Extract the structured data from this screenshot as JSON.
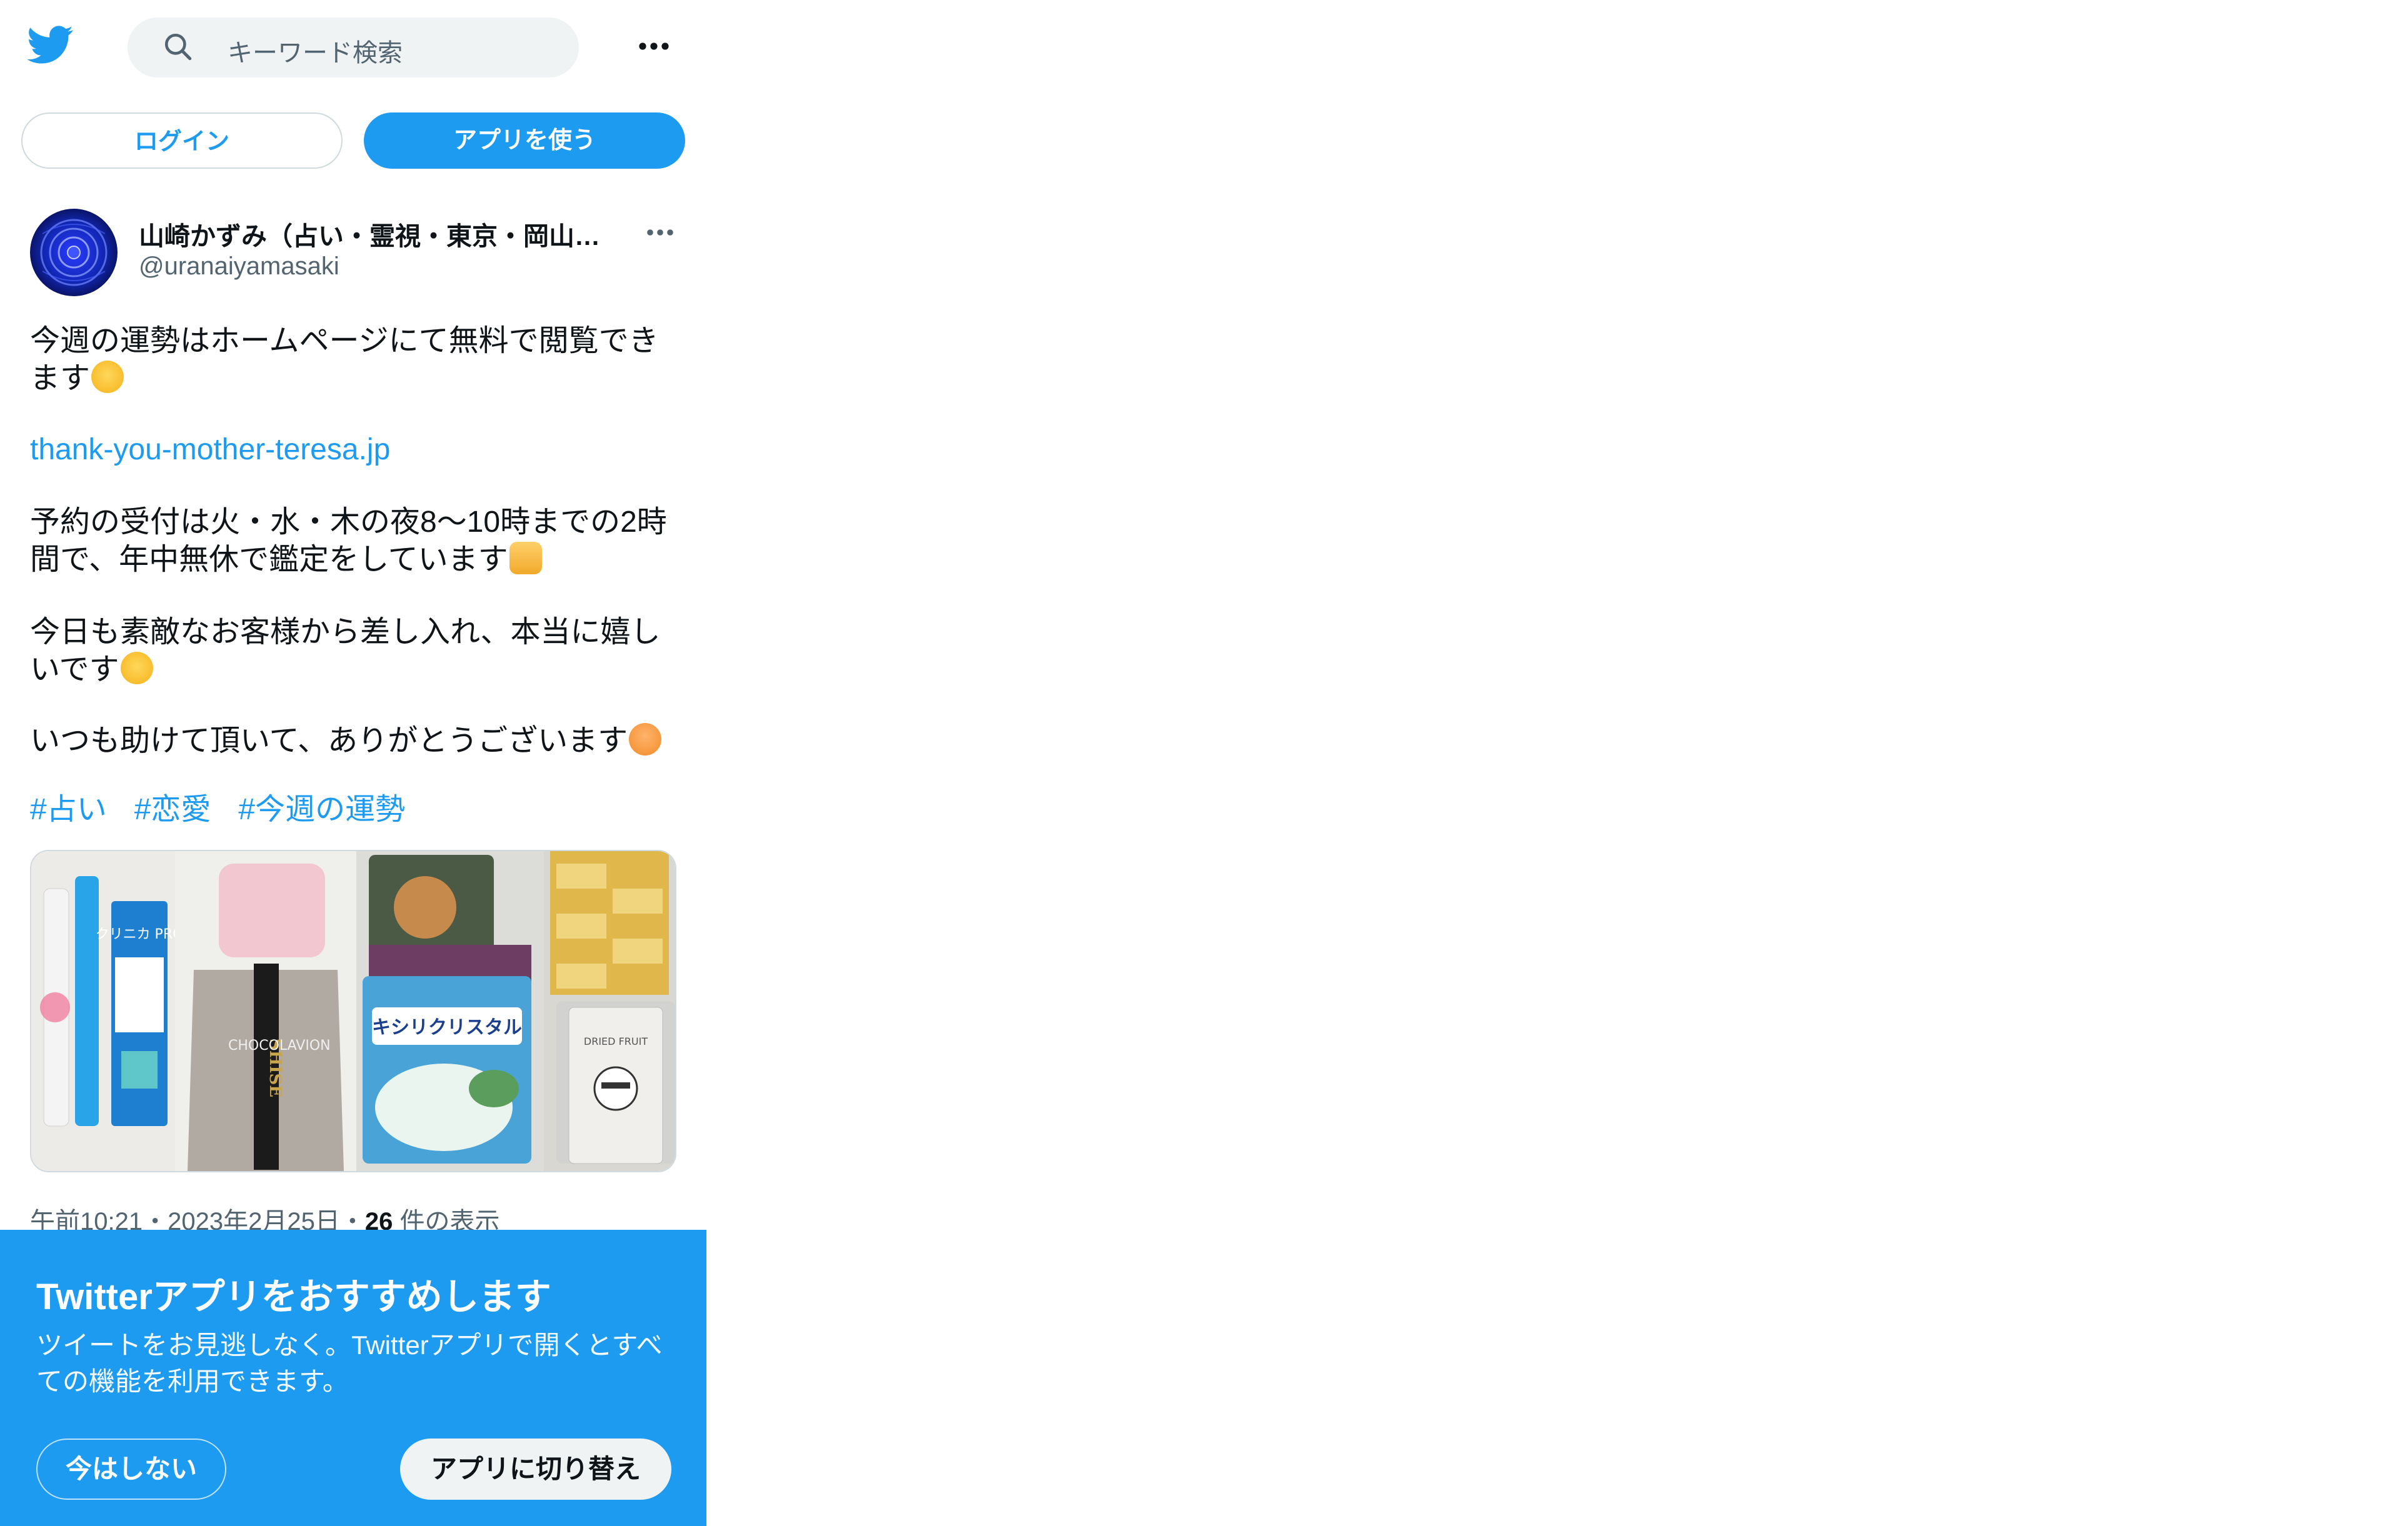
{
  "search": {
    "placeholder": "キーワード検索"
  },
  "header": {
    "login_label": "ログイン",
    "use_app_label": "アプリを使う"
  },
  "author": {
    "name": "山崎かずみ（占い・霊視・東京・岡山…",
    "handle": "@uranaiyamasaki"
  },
  "tweet": {
    "line1": "今週の運勢はホームページにて無料で閲覧できます",
    "emoji1": "smiling-face-emoji",
    "link": "thank-you-mother-teresa.jp",
    "line2": "予約の受付は火・水・木の夜8〜10時までの2時間で、年中無休で鑑定をしています",
    "emoji2": "folded-hands-emoji",
    "line3": "今日も素敵なお客様から差し入れ、本当に嬉しいです",
    "emoji3": "grinning-squinting-emoji",
    "line4": "いつも助けて頂いて、ありがとうございます",
    "emoji4": "person-bowing-emoji",
    "hashtags": [
      "#占い",
      "#恋愛",
      "#今週の運勢"
    ],
    "media": {
      "product1": "クリニカ PRO",
      "product2": "SHISE",
      "product3": "CHOCOLAVION",
      "product4": "キシリクリスタル",
      "product5": "DRIED FRUIT"
    },
    "time": "午前10:21",
    "date": "2023年2月25日",
    "views_count": "26",
    "views_label": "件の表示"
  },
  "banner": {
    "title": "Twitterアプリをおすすめします",
    "description": "ツイートをお見逃しなく。Twitterアプリで開くとすべての機能を利用できます。",
    "not_now_label": "今はしない",
    "switch_label": "アプリに切り替え"
  },
  "colors": {
    "accent": "#1d9bf0",
    "text": "#0f1419",
    "muted": "#536471"
  }
}
